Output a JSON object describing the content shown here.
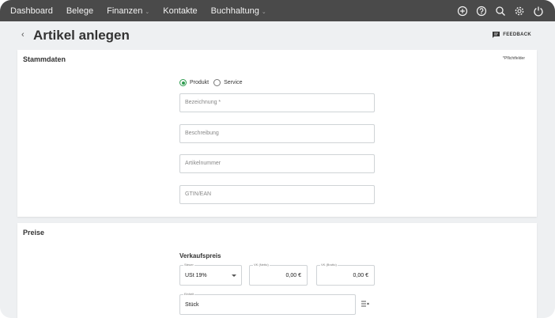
{
  "nav": {
    "items": [
      {
        "label": "Dashboard",
        "has_dropdown": false
      },
      {
        "label": "Belege",
        "has_dropdown": false
      },
      {
        "label": "Finanzen",
        "has_dropdown": true
      },
      {
        "label": "Kontakte",
        "has_dropdown": false
      },
      {
        "label": "Buchhaltung",
        "has_dropdown": true
      }
    ],
    "icons": [
      "add-circle-icon",
      "help-icon",
      "search-icon",
      "settings-gear-icon",
      "power-icon"
    ]
  },
  "header": {
    "back_glyph": "‹",
    "title": "Artikel anlegen",
    "feedback_label": "FEEDBACK"
  },
  "stammdaten": {
    "title": "Stammdaten",
    "required_note": "*Pflichtfelder",
    "type_options": [
      {
        "label": "Produkt",
        "selected": true
      },
      {
        "label": "Service",
        "selected": false
      }
    ],
    "fields": [
      {
        "placeholder": "Bezeichnung *",
        "value": ""
      },
      {
        "placeholder": "Beschreibung",
        "value": ""
      },
      {
        "placeholder": "Artikelnummer",
        "value": ""
      },
      {
        "placeholder": "GTIN/EAN",
        "value": ""
      }
    ]
  },
  "preise": {
    "title": "Preise",
    "subheading": "Verkaufspreis",
    "steuer": {
      "label": "Steuer",
      "value": "USt 19%"
    },
    "vk_netto": {
      "label": "VK (Netto)",
      "value": "0,00 €"
    },
    "vk_brutto": {
      "label": "VK (Brutto)",
      "value": "0,00 €"
    },
    "einheit": {
      "label": "Einheit",
      "value": "Stück"
    }
  },
  "colors": {
    "topbar": "#4a4a4a",
    "accent_green": "#2e9c4f",
    "page_bg": "#eef0f2"
  }
}
